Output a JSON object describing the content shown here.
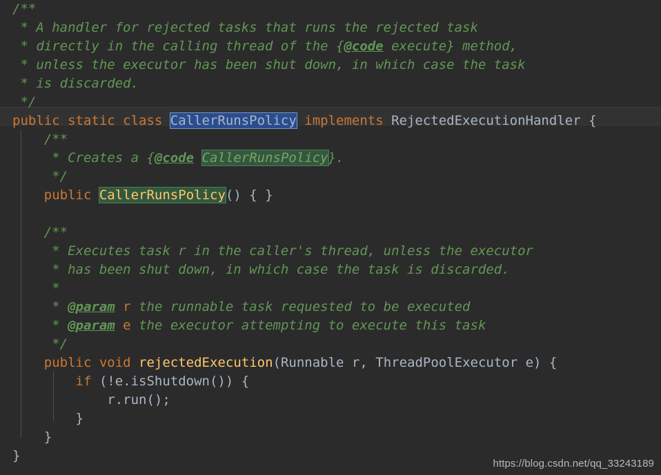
{
  "editor": {
    "language": "java",
    "theme": "darcula",
    "background_color": "#2b2b2b",
    "current_line_color": "#323232",
    "default_text_color": "#a9b7c6",
    "comment_color": "#629755",
    "keyword_color": "#cc7832",
    "method_color": "#ffc66d",
    "selection_color": "#2a4d8f",
    "match_highlight_color": "#32593d",
    "font_size_px": 19,
    "line_height_px": 27,
    "highlighted_line_number": 7,
    "selected_text": "CallerRunsPolicy"
  },
  "code": {
    "lines": [
      {
        "n": 1,
        "text": "/**"
      },
      {
        "n": 2,
        "text": " * A handler for rejected tasks that runs the rejected task"
      },
      {
        "n": 3,
        "text": " * directly in the calling thread of the {@code execute} method,"
      },
      {
        "n": 4,
        "text": " * unless the executor has been shut down, in which case the task"
      },
      {
        "n": 5,
        "text": " * is discarded."
      },
      {
        "n": 6,
        "text": " */"
      },
      {
        "n": 7,
        "text": "public static class CallerRunsPolicy implements RejectedExecutionHandler {"
      },
      {
        "n": 8,
        "text": "    /**"
      },
      {
        "n": 9,
        "text": "     * Creates a {@code CallerRunsPolicy}."
      },
      {
        "n": 10,
        "text": "     */"
      },
      {
        "n": 11,
        "text": "    public CallerRunsPolicy() { }"
      },
      {
        "n": 12,
        "text": ""
      },
      {
        "n": 13,
        "text": "    /**"
      },
      {
        "n": 14,
        "text": "     * Executes task r in the caller's thread, unless the executor"
      },
      {
        "n": 15,
        "text": "     * has been shut down, in which case the task is discarded."
      },
      {
        "n": 16,
        "text": "     *"
      },
      {
        "n": 17,
        "text": "     * @param r the runnable task requested to be executed"
      },
      {
        "n": 18,
        "text": "     * @param e the executor attempting to execute this task"
      },
      {
        "n": 19,
        "text": "     */"
      },
      {
        "n": 20,
        "text": "    public void rejectedExecution(Runnable r, ThreadPoolExecutor e) {"
      },
      {
        "n": 21,
        "text": "        if (!e.isShutdown()) {"
      },
      {
        "n": 22,
        "text": "            r.run();"
      },
      {
        "n": 23,
        "text": "        }"
      },
      {
        "n": 24,
        "text": "    }"
      },
      {
        "n": 25,
        "text": "}"
      }
    ],
    "tokens": {
      "comment_open": "/**",
      "comment_star": "*",
      "comment_close": "*/",
      "tag_code": "@code",
      "tag_param": "@param",
      "kw_public": "public",
      "kw_static": "static",
      "kw_class": "class",
      "kw_implements": "implements",
      "kw_void": "void",
      "kw_if": "if",
      "class_name": "CallerRunsPolicy",
      "interface_name": "RejectedExecutionHandler",
      "method_name": "rejectedExecution",
      "param_type_1": "Runnable",
      "param_type_2": "ThreadPoolExecutor",
      "param_name_1": "r",
      "param_name_2": "e"
    },
    "text_fragments": {
      "l1": "/**",
      "l2a": " * ",
      "l2b": "A handler for rejected tasks that runs the rejected task",
      "l3a": " * ",
      "l3b": "directly in the calling thread of the {",
      "l3c": "@code",
      "l3d": " execute} method,",
      "l4a": " * ",
      "l4b": "unless the executor has been shut down, in which case the task",
      "l5a": " * ",
      "l5b": "is discarded.",
      "l6": " */",
      "l7a": "public static class ",
      "l7b": "CallerRunsPolicy",
      "l7c": " ",
      "l7d": "implements",
      "l7e": " RejectedExecutionHandler {",
      "l8": "    /**",
      "l9a": "     * ",
      "l9b": "Creates a {",
      "l9c": "@code",
      "l9d": " ",
      "l9e": "CallerRunsPolicy",
      "l9f": "}.",
      "l10": "     */",
      "l11a": "    ",
      "l11b": "public",
      "l11c": " ",
      "l11d": "CallerRunsPolicy",
      "l11e": "() { }",
      "l12": "",
      "l13": "    /**",
      "l14a": "     * ",
      "l14b": "Executes task r in the caller's thread, unless the executor",
      "l15a": "     * ",
      "l15b": "has been shut down, in which case the task is discarded.",
      "l16": "     *",
      "l17a": "     * ",
      "l17b": "@param",
      "l17c": " ",
      "l17d": "r",
      "l17e": " the runnable task requested to be executed",
      "l18a": "     * ",
      "l18b": "@param",
      "l18c": " ",
      "l18d": "e",
      "l18e": " the executor attempting to execute this task",
      "l19": "     */",
      "l20a": "    ",
      "l20b": "public void ",
      "l20c": "rejectedExecution",
      "l20d": "(",
      "l20e": "Runnable",
      "l20f": " r, ",
      "l20g": "ThreadPoolExecutor",
      "l20h": " e) {",
      "l21a": "        ",
      "l21b": "if",
      "l21c": " (!e.isShutdown()) {",
      "l22": "            r.run();",
      "l23": "        }",
      "l24": "    }",
      "l25": "}"
    }
  },
  "watermark": {
    "text": "https://blog.csdn.net/qq_33243189"
  }
}
